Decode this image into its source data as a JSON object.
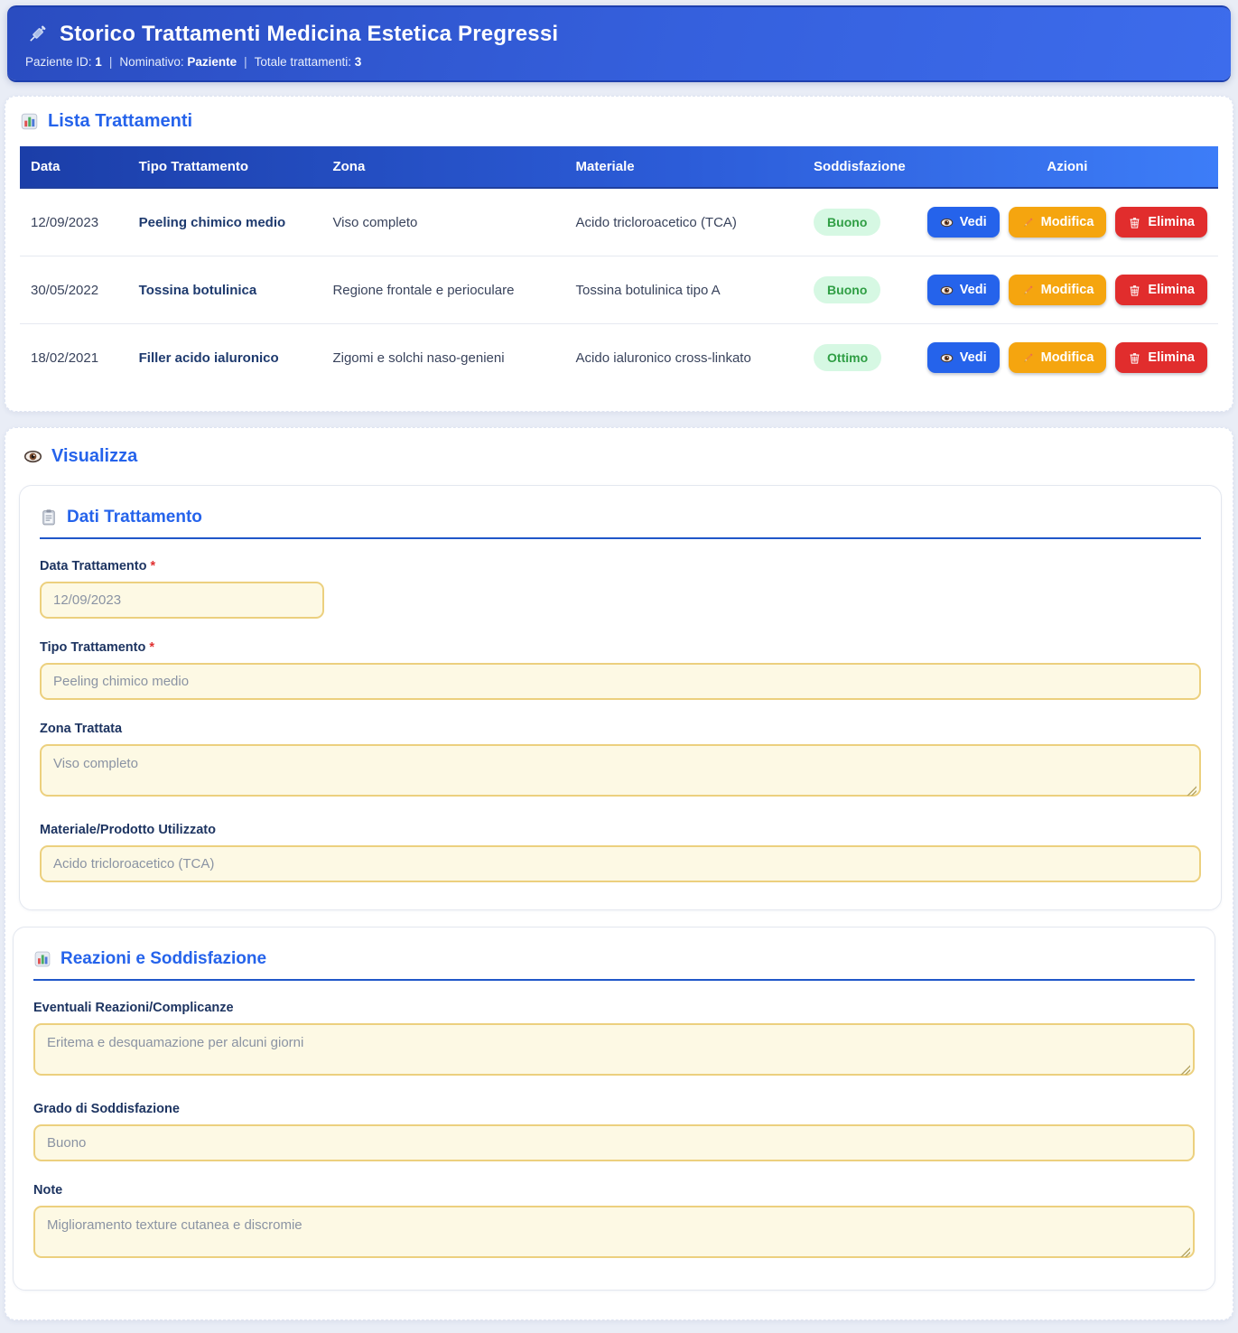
{
  "colors": {
    "header_blue": "#2a4cc0",
    "accent_blue": "#2563eb",
    "table_head_from": "#1b3ea8",
    "table_head_to": "#3d7df8",
    "button_view": "#2563eb",
    "button_edit": "#f5a50f",
    "button_delete": "#e12d2d",
    "badge_bg": "#d6f8e3",
    "badge_text": "#2f9e44",
    "input_bg": "#fdf9e4",
    "input_border": "#ecd07e"
  },
  "header": {
    "icon": "syringe-icon",
    "title": "Storico Trattamenti Medicina Estetica Pregressi",
    "separator": "|",
    "meta": [
      {
        "label": "Paziente ID:",
        "value": "1"
      },
      {
        "label": "Nominativo:",
        "value": "Paziente"
      },
      {
        "label": "Totale trattamenti:",
        "value": "3"
      }
    ]
  },
  "treatments_section": {
    "icon": "chart-icon",
    "title": "Lista Trattamenti",
    "table": {
      "columns": [
        "Data",
        "Tipo Trattamento",
        "Zona",
        "Materiale",
        "Soddisfazione",
        "Azioni"
      ],
      "rows": [
        {
          "data": "12/09/2023",
          "tipo": "Peeling chimico medio",
          "zona": "Viso completo",
          "materiale": "Acido tricloroacetico (TCA)",
          "soddisfazione": "Buono"
        },
        {
          "data": "30/05/2022",
          "tipo": "Tossina botulinica",
          "zona": "Regione frontale e perioculare",
          "materiale": "Tossina botulinica tipo A",
          "soddisfazione": "Buono"
        },
        {
          "data": "18/02/2021",
          "tipo": "Filler acido ialuronico",
          "zona": "Zigomi e solchi naso-genieni",
          "materiale": "Acido ialuronico cross-linkato",
          "soddisfazione": "Ottimo"
        }
      ],
      "actions": [
        {
          "name": "view",
          "icon": "eye-icon",
          "label": "Vedi"
        },
        {
          "name": "edit",
          "icon": "pencil-icon",
          "label": "Modifica"
        },
        {
          "name": "delete",
          "icon": "trash-icon",
          "label": "Elimina"
        }
      ]
    }
  },
  "view_section": {
    "icon": "eye-icon",
    "title": "Visualizza",
    "dati": {
      "icon": "clipboard-icon",
      "title": "Dati Trattamento",
      "fields": [
        {
          "name": "data-trattamento",
          "label": "Data Trattamento",
          "required": true,
          "value": "12/09/2023",
          "control": "input",
          "size": "narrow"
        },
        {
          "name": "tipo-trattamento",
          "label": "Tipo Trattamento",
          "required": true,
          "value": "Peeling chimico medio",
          "control": "input",
          "size": "full"
        },
        {
          "name": "zona-trattata",
          "label": "Zona Trattata",
          "required": false,
          "value": "Viso completo",
          "control": "textarea",
          "size": "full"
        },
        {
          "name": "materiale-prodotto",
          "label": "Materiale/Prodotto Utilizzato",
          "required": false,
          "value": "Acido tricloroacetico (TCA)",
          "control": "input",
          "size": "full"
        }
      ]
    },
    "reazioni": {
      "icon": "chart-icon",
      "title": "Reazioni e Soddisfazione",
      "fields": [
        {
          "name": "reazioni-complicanze",
          "label": "Eventuali Reazioni/Complicanze",
          "required": false,
          "value": "Eritema e desquamazione per alcuni giorni",
          "control": "textarea",
          "size": "full"
        },
        {
          "name": "grado-soddisfazione",
          "label": "Grado di Soddisfazione",
          "required": false,
          "value": "Buono",
          "control": "input",
          "size": "full"
        },
        {
          "name": "note",
          "label": "Note",
          "required": false,
          "value": "Miglioramento texture cutanea e discromie",
          "control": "textarea",
          "size": "full"
        }
      ]
    }
  }
}
